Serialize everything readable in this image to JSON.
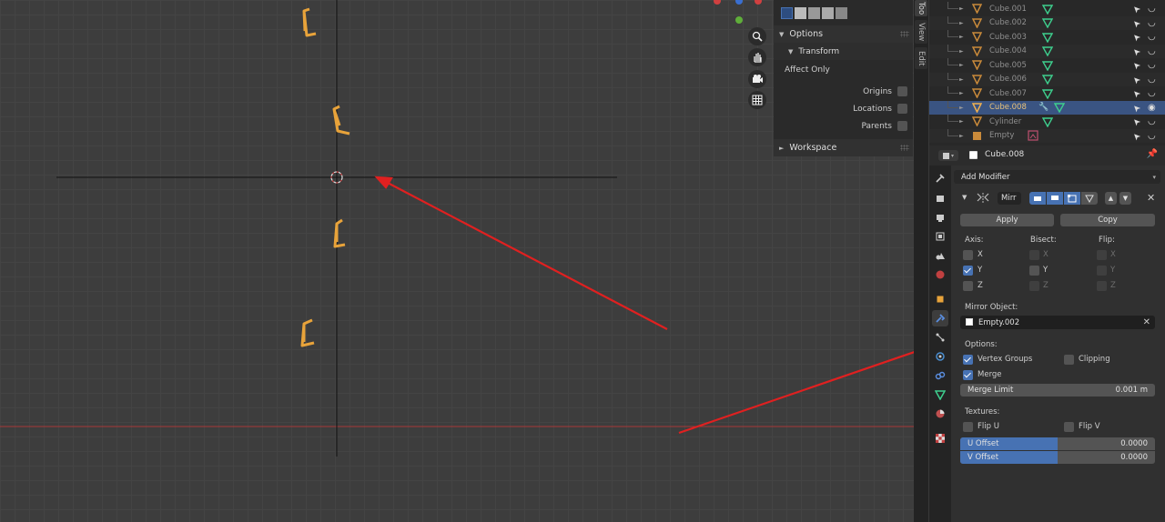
{
  "tool_panel": {
    "options_label": "Options",
    "transform_label": "Transform",
    "affect_only_label": "Affect Only",
    "origins_label": "Origins",
    "locations_label": "Locations",
    "parents_label": "Parents",
    "workspace_label": "Workspace"
  },
  "side_tabs": [
    "Too",
    "View",
    "Edit"
  ],
  "outliner": {
    "rows": [
      {
        "name": "Cube.001",
        "type": "mesh"
      },
      {
        "name": "Cube.002",
        "type": "mesh"
      },
      {
        "name": "Cube.003",
        "type": "mesh"
      },
      {
        "name": "Cube.004",
        "type": "mesh"
      },
      {
        "name": "Cube.005",
        "type": "mesh"
      },
      {
        "name": "Cube.006",
        "type": "mesh"
      },
      {
        "name": "Cube.007",
        "type": "mesh"
      },
      {
        "name": "Cube.008",
        "type": "mesh",
        "selected": true
      },
      {
        "name": "Cylinder",
        "type": "mesh"
      },
      {
        "name": "Empty",
        "type": "empty"
      }
    ]
  },
  "properties": {
    "object_name": "Cube.008",
    "add_modifier_label": "Add Modifier",
    "modifier_name": "Mirr",
    "apply_label": "Apply",
    "copy_label": "Copy",
    "axis_label": "Axis:",
    "bisect_label": "Bisect:",
    "flip_label": "Flip:",
    "x_label": "X",
    "y_label": "Y",
    "z_label": "Z",
    "axis_x": false,
    "axis_y": true,
    "axis_z": false,
    "mirror_object_label": "Mirror Object:",
    "mirror_object_value": "Empty.002",
    "options_label": "Options:",
    "vertex_groups_label": "Vertex Groups",
    "clipping_label": "Clipping",
    "merge_label": "Merge",
    "merge_limit_label": "Merge Limit",
    "merge_limit_value": "0.001 m",
    "textures_label": "Textures:",
    "flip_u_label": "Flip U",
    "flip_v_label": "Flip V",
    "u_offset_label": "U Offset",
    "u_offset_value": "0.0000",
    "v_offset_label": "V Offset",
    "v_offset_value": "0.0000"
  },
  "colors": {
    "selection_orange": "#e8a33a",
    "annotation_red": "#e02020",
    "accent_blue": "#4772b3",
    "x_axis_red": "#b03030"
  }
}
